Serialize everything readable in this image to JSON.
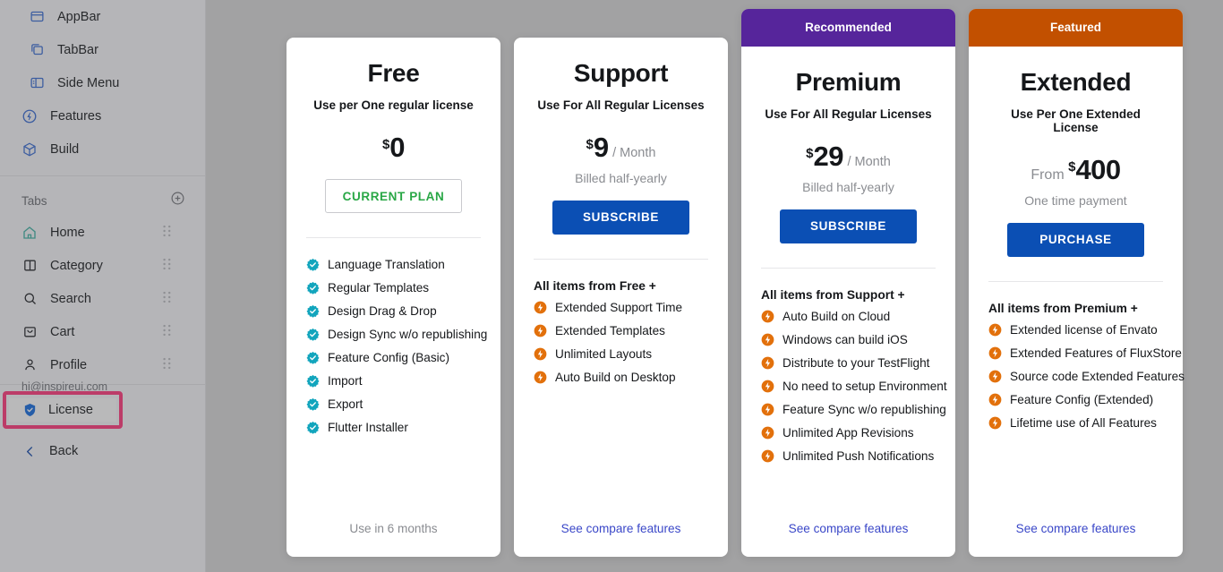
{
  "sidebar": {
    "nav_items": [
      {
        "label": "AppBar",
        "icon": "appbar-icon"
      },
      {
        "label": "TabBar",
        "icon": "tabbar-icon"
      },
      {
        "label": "Side Menu",
        "icon": "side-menu-icon"
      },
      {
        "label": "Features",
        "icon": "features-icon"
      },
      {
        "label": "Build",
        "icon": "build-icon"
      }
    ],
    "tabs_section": {
      "label": "Tabs",
      "add_icon": "plus-circle-icon"
    },
    "tabs": [
      {
        "label": "Home",
        "icon": "home-icon"
      },
      {
        "label": "Category",
        "icon": "category-icon"
      },
      {
        "label": "Search",
        "icon": "search-icon"
      },
      {
        "label": "Cart",
        "icon": "cart-icon"
      },
      {
        "label": "Profile",
        "icon": "profile-icon"
      }
    ],
    "email": "hi@inspireui.com",
    "license": {
      "label": "License",
      "icon": "shield-check-icon",
      "highlight_color": "#ff3d7f"
    },
    "back": {
      "label": "Back",
      "icon": "chevron-left-icon"
    }
  },
  "plans": [
    {
      "id": "free",
      "banner": null,
      "name": "Free",
      "subtitle": "Use per One regular license",
      "price_from": null,
      "currency": "$",
      "amount": "0",
      "period": null,
      "billed": null,
      "cta": {
        "label": "CURRENT PLAN",
        "style": "outline"
      },
      "inherits": null,
      "bullet_style": "check",
      "features": [
        "Language Translation",
        "Regular Templates",
        "Design Drag & Drop",
        "Design Sync w/o republishing",
        "Feature Config (Basic)",
        "Import",
        "Export",
        "Flutter Installer"
      ],
      "footer_note": "Use in 6 months",
      "footer_link": null
    },
    {
      "id": "support",
      "banner": null,
      "name": "Support",
      "subtitle": "Use For All Regular Licenses",
      "price_from": null,
      "currency": "$",
      "amount": "9",
      "period": "/ Month",
      "billed": "Billed half-yearly",
      "cta": {
        "label": "SUBSCRIBE",
        "style": "primary"
      },
      "inherits": "All items from Free  +",
      "bullet_style": "bolt",
      "features": [
        "Extended Support Time",
        "Extended Templates",
        "Unlimited Layouts",
        "Auto Build on Desktop"
      ],
      "footer_note": null,
      "footer_link": "See compare features"
    },
    {
      "id": "premium",
      "banner": {
        "label": "Recommended",
        "color": "#56259b"
      },
      "name": "Premium",
      "subtitle": "Use For All Regular Licenses",
      "price_from": null,
      "currency": "$",
      "amount": "29",
      "period": "/ Month",
      "billed": "Billed half-yearly",
      "cta": {
        "label": "SUBSCRIBE",
        "style": "primary"
      },
      "inherits": "All items from Support  +",
      "bullet_style": "bolt",
      "features": [
        "Auto Build on Cloud",
        "Windows can build iOS",
        "Distribute to your TestFlight",
        "No need to setup Environment",
        "Feature Sync w/o republishing",
        "Unlimited App Revisions",
        "Unlimited Push Notifications"
      ],
      "footer_note": null,
      "footer_link": "See compare features"
    },
    {
      "id": "extended",
      "banner": {
        "label": "Featured",
        "color": "#c25000"
      },
      "name": "Extended",
      "subtitle": "Use Per One Extended License",
      "price_from": "From",
      "currency": "$",
      "amount": "400",
      "period": null,
      "billed": "One time payment",
      "cta": {
        "label": "PURCHASE",
        "style": "primary"
      },
      "inherits": "All items from Premium +",
      "bullet_style": "bolt",
      "features": [
        "Extended license of Envato",
        "Extended Features of FluxStore",
        "Source code Extended Features",
        "Feature Config (Extended)",
        "Lifetime use of All Features"
      ],
      "footer_note": null,
      "footer_link": "See compare features"
    }
  ],
  "colors": {
    "primary_button": "#0b4fb4",
    "current_plan_text": "#28a745",
    "check_bullet": "#12a5bd",
    "bolt_bullet": "#e2700b",
    "link": "#3a47c8",
    "recommended_banner": "#56259b",
    "featured_banner": "#c25000",
    "highlight_box": "#ff3d7f"
  }
}
